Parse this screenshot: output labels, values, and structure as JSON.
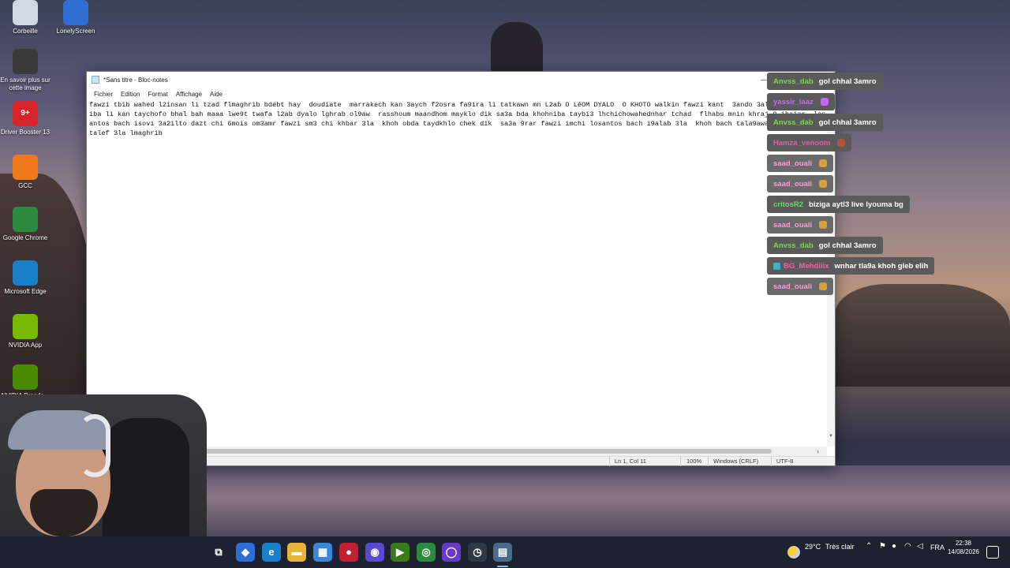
{
  "desktop": {
    "icons": [
      {
        "label": "Corbeille",
        "icon": "recycle-bin-icon",
        "color": "#cfd8e3"
      },
      {
        "label": "LonelyScreen",
        "icon": "monitor-icon",
        "color": "#2f6fcf"
      },
      {
        "label": "En savoir plus sur cette image",
        "icon": "camera-icon",
        "color": "#3a3a3a"
      },
      {
        "label": "Driver Booster 13",
        "icon": "driver-booster-icon",
        "color": "#d8232a"
      },
      {
        "label": "GCC",
        "icon": "gcc-icon",
        "color": "#f07a1a"
      },
      {
        "label": "Google Chrome",
        "icon": "chrome-icon",
        "color": "#2c8a3e"
      },
      {
        "label": "Microsoft Edge",
        "icon": "edge-icon",
        "color": "#1a7fc9"
      },
      {
        "label": "NVIDIA App",
        "icon": "nvidia-icon",
        "color": "#76b900"
      },
      {
        "label": "NVIDIA Broadc...",
        "icon": "nvidia-broadcast-icon",
        "color": "#4a8a00"
      }
    ],
    "driver_booster_badge": "9+"
  },
  "notepad": {
    "title": "*Sans titre - Bloc-notes",
    "menu": [
      "Fichier",
      "Edition",
      "Format",
      "Affichage",
      "Aide"
    ],
    "content": "fawzi tbib wahed l2insan li tzad flmaghrib bdebt hay  doudiate  marrakech kan 3aych f2osra fa9ira li tatkawn mn L2ab O LéOM DYALO  O KHOTO walkin fawzi kant  3ando 3ala9a wat khoh niba li kan taychofo bhal bah maaa lwe9t twafa l2ab dyalo lghrab ol9aw  rasshoum maandhom mayklo dik sa3a bda khohniba taybi3 lhchichowahednhar tchad  flhabs mnin khraj 9 ihajar  losantos bach isovi 3a2ilto dazt chi 6mois om3amr fawzi sm3 chi khbar 3la  khoh obda taydkhlo chek dik  sa3a 9rar fawzi imchi losantos bach i9alab 3la  khoh bach tala9awahed l3alem mkhtalef 3la lmaghrib",
    "status": {
      "position": "Ln 1, Col 11",
      "zoom": "100%",
      "line_ending": "Windows (CRLF)",
      "encoding": "UTF-8"
    },
    "controls": {
      "minimize": "—",
      "maximize": "☐",
      "close": "✕"
    }
  },
  "chat": [
    {
      "user": "Anvss_dab",
      "message": "gol chhal 3amro",
      "user_color": "#7ad84a",
      "bg": "#5a5a5a"
    },
    {
      "user": "yassir_laaz",
      "message": "",
      "user_color": "#c566ff",
      "bg": "#5a5a5a",
      "emote_color": "#c566ff"
    },
    {
      "user": "Anvss_dab",
      "message": "gol chhal 3amro",
      "user_color": "#7ad84a",
      "bg": "#5a5a5a"
    },
    {
      "user": "Hamza_venoom",
      "message": "",
      "user_color": "#ff4fa8",
      "bg": "#5a5a5a",
      "emote_color": "#b0543c"
    },
    {
      "user": "saad_ouali",
      "message": "",
      "user_color": "#ff9ad8",
      "bg": "#6a6a6a",
      "emote_color": "#d8a040"
    },
    {
      "user": "saad_ouali",
      "message": "",
      "user_color": "#ff9ad8",
      "bg": "#6a6a6a",
      "emote_color": "#d8a040"
    },
    {
      "user": "critosR2",
      "message": "biziga aytl3 live lyouma bg",
      "user_color": "#55e36a",
      "bg": "#5a5a5a"
    },
    {
      "user": "saad_ouali",
      "message": "",
      "user_color": "#ff9ad8",
      "bg": "#6a6a6a",
      "emote_color": "#d8a040"
    },
    {
      "user": "Anvss_dab",
      "message": "gol chhal 3amro",
      "user_color": "#7ad84a",
      "bg": "#5a5a5a"
    },
    {
      "user": "BG_Mehdiiix",
      "message": "wnhar tla9a khoh gleb elih",
      "user_color": "#ff5aa0",
      "bg": "#5a5a5a",
      "badge": true
    },
    {
      "user": "saad_ouali",
      "message": "",
      "user_color": "#ff9ad8",
      "bg": "#6a6a6a",
      "emote_color": "#d8a040"
    }
  ],
  "taskbar": {
    "weather": {
      "temp": "29°C",
      "condition": "Très clair"
    },
    "language": "FRA",
    "time": "22:38",
    "date": "14/08/2026",
    "apps": [
      {
        "name": "task-view-icon",
        "glyph": "⧉",
        "color": "#1c2230"
      },
      {
        "name": "copilot-icon",
        "glyph": "◆",
        "color": "#2b6fd6"
      },
      {
        "name": "edge-taskbar-icon",
        "glyph": "e",
        "color": "#1a7fc9"
      },
      {
        "name": "file-explorer-icon",
        "glyph": "▬",
        "color": "#e8b43a"
      },
      {
        "name": "store-icon",
        "glyph": "▦",
        "color": "#3a86d8"
      },
      {
        "name": "app-red-icon",
        "glyph": "●",
        "color": "#c02030"
      },
      {
        "name": "obs-icon",
        "glyph": "◉",
        "color": "#5a4ad0"
      },
      {
        "name": "nvidia-broadcast-taskbar-icon",
        "glyph": "▶",
        "color": "#3b7a18"
      },
      {
        "name": "chrome-taskbar-icon",
        "glyph": "◎",
        "color": "#2c8a3e"
      },
      {
        "name": "app-purple-icon",
        "glyph": "◯",
        "color": "#6a38c8"
      },
      {
        "name": "recorder-icon",
        "glyph": "◷",
        "color": "#303846"
      },
      {
        "name": "notepad-taskbar-icon",
        "glyph": "▤",
        "color": "#4a6a8a"
      }
    ]
  }
}
